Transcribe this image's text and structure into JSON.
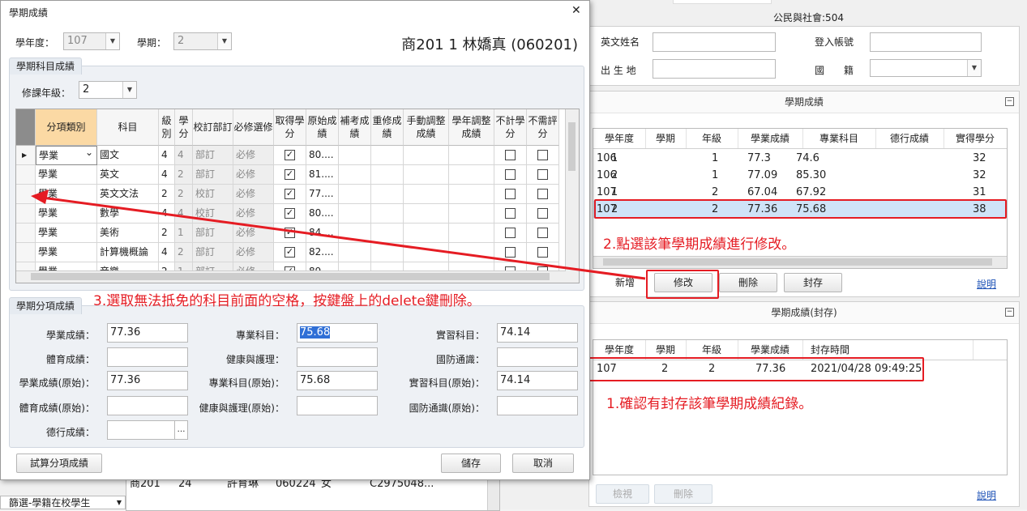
{
  "bg": {
    "class_header": "公民與社會:504",
    "fields": {
      "english_name_label": "英文姓名",
      "birthplace_label": "出 生 地",
      "login_label": "登入帳號",
      "nationality_label": "國　　籍"
    },
    "semester_panel": {
      "title": "學期成績",
      "columns": [
        "學年度",
        "學期",
        "年級",
        "學業成績",
        "專業科目",
        "德行成績",
        "實得學分"
      ],
      "rows": [
        [
          "106",
          "1",
          "1",
          "77.3",
          "74.6",
          "",
          "32"
        ],
        [
          "106",
          "2",
          "1",
          "77.09",
          "85.30",
          "",
          "32"
        ],
        [
          "107",
          "1",
          "2",
          "67.04",
          "67.92",
          "",
          "31"
        ],
        [
          "107",
          "2",
          "2",
          "77.36",
          "75.68",
          "",
          "38"
        ]
      ],
      "buttons": {
        "add": "新增",
        "edit": "修改",
        "delete": "刪除",
        "archive": "封存"
      },
      "help": "說明"
    },
    "archive_panel": {
      "title": "學期成績(封存)",
      "columns": [
        "學年度",
        "學期",
        "年級",
        "學業成績",
        "封存時間"
      ],
      "rows": [
        [
          "107",
          "2",
          "2",
          "77.36",
          "2021/04/28 09:49:25"
        ]
      ],
      "buttons": {
        "view": "檢視",
        "delete": "刪除"
      },
      "help": "說明"
    },
    "bottom_list": {
      "row1": [
        "商201",
        "24",
        "許育琳",
        "060224",
        "女",
        "C2975048..."
      ],
      "filter_label": "篩選-學籍在校學生"
    }
  },
  "annotations": {
    "note1": "1.確認有封存該筆學期成績紀錄。",
    "note2": "2.點選該筆學期成績進行修改。",
    "note3": "3.選取無法抵免的科目前面的空格，按鍵盤上的delete鍵刪除。"
  },
  "dialog": {
    "title": "學期成績",
    "close": "✕",
    "year_label": "學年度：",
    "year_value": "107",
    "term_label": "學期：",
    "term_value": "2",
    "student_info": "商201 1 林嬌真 (060201)",
    "subject_group_title": "學期科目成績",
    "grade_level_label": "修課年級：",
    "grade_level_value": "2",
    "columns": [
      "分項類別",
      "科目",
      "級別",
      "學分",
      "校訂部訂",
      "必修選修",
      "取得學分",
      "原始成績",
      "補考成績",
      "重修成績",
      "手動調整成績",
      "學年調整成績",
      "不計學分",
      "不需評分"
    ],
    "subjects": [
      {
        "cat": "學業",
        "name": "國文",
        "level": "4",
        "credit": "4",
        "type": "部訂",
        "req": "必修",
        "score": "80...."
      },
      {
        "cat": "學業",
        "name": "英文",
        "level": "4",
        "credit": "2",
        "type": "部訂",
        "req": "必修",
        "score": "81...."
      },
      {
        "cat": "學業",
        "name": "英文文法",
        "level": "2",
        "credit": "2",
        "type": "校訂",
        "req": "必修",
        "score": "77...."
      },
      {
        "cat": "學業",
        "name": "數學",
        "level": "4",
        "credit": "4",
        "type": "校訂",
        "req": "必修",
        "score": "80...."
      },
      {
        "cat": "學業",
        "name": "美術",
        "level": "2",
        "credit": "1",
        "type": "部訂",
        "req": "必修",
        "score": "84...."
      },
      {
        "cat": "學業",
        "name": "計算機概論",
        "level": "4",
        "credit": "2",
        "type": "部訂",
        "req": "必修",
        "score": "82...."
      },
      {
        "cat": "學業",
        "name": "音樂",
        "level": "2",
        "credit": "1",
        "type": "部訂",
        "req": "必修",
        "score": "89...."
      }
    ],
    "sub_group_title": "學期分項成績",
    "fields": {
      "academic_label": "學業成績：",
      "academic": "77.36",
      "major_label": "專業科目：",
      "major": "75.68",
      "practice_label": "實習科目：",
      "practice": "74.14",
      "pe_label": "體育成績：",
      "pe": "",
      "health_label": "健康與護理：",
      "health": "",
      "defense_label": "國防通識：",
      "defense": "",
      "academic_raw_label": "學業成績(原始)：",
      "academic_raw": "77.36",
      "major_raw_label": "專業科目(原始)：",
      "major_raw": "75.68",
      "practice_raw_label": "實習科目(原始)：",
      "practice_raw": "74.14",
      "pe_raw_label": "體育成績(原始)：",
      "pe_raw": "",
      "health_raw_label": "健康與護理(原始)：",
      "health_raw": "",
      "defense_raw_label": "國防通識(原始)：",
      "defense_raw": "",
      "conduct_label": "德行成績：",
      "conduct": ""
    },
    "buttons": {
      "calc": "試算分項成績",
      "save": "儲存",
      "cancel": "取消"
    }
  }
}
